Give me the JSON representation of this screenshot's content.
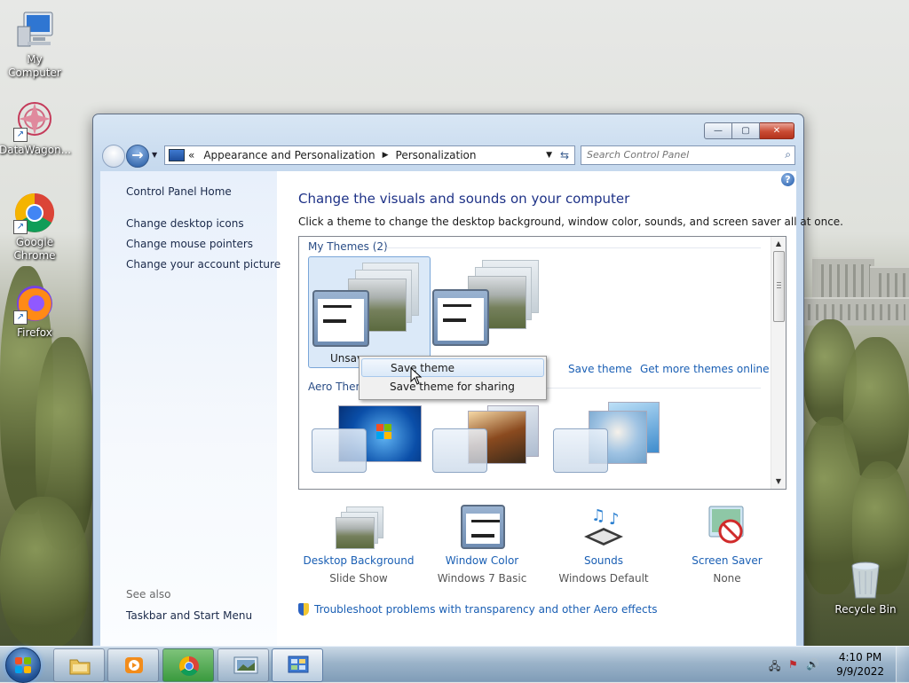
{
  "desktop": {
    "icons": [
      {
        "label": "My Computer",
        "icon": "computer-icon"
      },
      {
        "label": "DataWagon...",
        "icon": "datawagon-icon"
      },
      {
        "label": "Google Chrome",
        "icon": "chrome-icon"
      },
      {
        "label": "Firefox",
        "icon": "firefox-icon"
      },
      {
        "label": "Recycle Bin",
        "icon": "recycle-bin-icon"
      }
    ]
  },
  "window": {
    "breadcrumb": {
      "prefix": "«",
      "items": [
        "Appearance and Personalization",
        "Personalization"
      ]
    },
    "search_placeholder": "Search Control Panel"
  },
  "leftpane": {
    "home": "Control Panel Home",
    "links": [
      "Change desktop icons",
      "Change mouse pointers",
      "Change your account picture"
    ],
    "see_also_title": "See also",
    "see_also_links": [
      "Taskbar and Start Menu"
    ]
  },
  "main": {
    "title": "Change the visuals and sounds on your computer",
    "description": "Click a theme to change the desktop background, window color, sounds, and screen saver all at once.",
    "my_themes_header": "My Themes (2)",
    "unsaved_label": "Unsav",
    "aero_themes_header": "Aero Themes (7)",
    "save_theme_link": "Save theme",
    "get_more_link": "Get more themes online",
    "bottom_items": [
      {
        "title": "Desktop Background",
        "value": "Slide Show"
      },
      {
        "title": "Window Color",
        "value": "Windows 7 Basic"
      },
      {
        "title": "Sounds",
        "value": "Windows Default"
      },
      {
        "title": "Screen Saver",
        "value": "None"
      }
    ],
    "troubleshoot_link": "Troubleshoot problems with transparency and other Aero effects"
  },
  "context_menu": {
    "items": [
      "Save theme",
      "Save theme for sharing"
    ]
  },
  "taskbar": {
    "time": "4:10 PM",
    "date": "9/9/2022"
  },
  "colors": {
    "link": "#1a5fb4",
    "title_blue": "#1e3287",
    "close_red": "#c94b33"
  }
}
